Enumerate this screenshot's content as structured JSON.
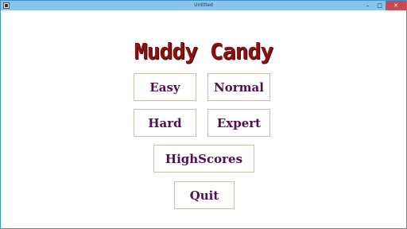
{
  "window": {
    "title": "Untitled",
    "controls": {
      "minimize": "–",
      "maximize": "□",
      "close": "✕"
    },
    "icon": "app-icon"
  },
  "game": {
    "title": "Muddy Candy",
    "title_color": "#8c1010",
    "button_text_color": "#520f50"
  },
  "menu": {
    "easy": "Easy",
    "normal": "Normal",
    "hard": "Hard",
    "expert": "Expert",
    "highscores": "HighScores",
    "quit": "Quit"
  }
}
